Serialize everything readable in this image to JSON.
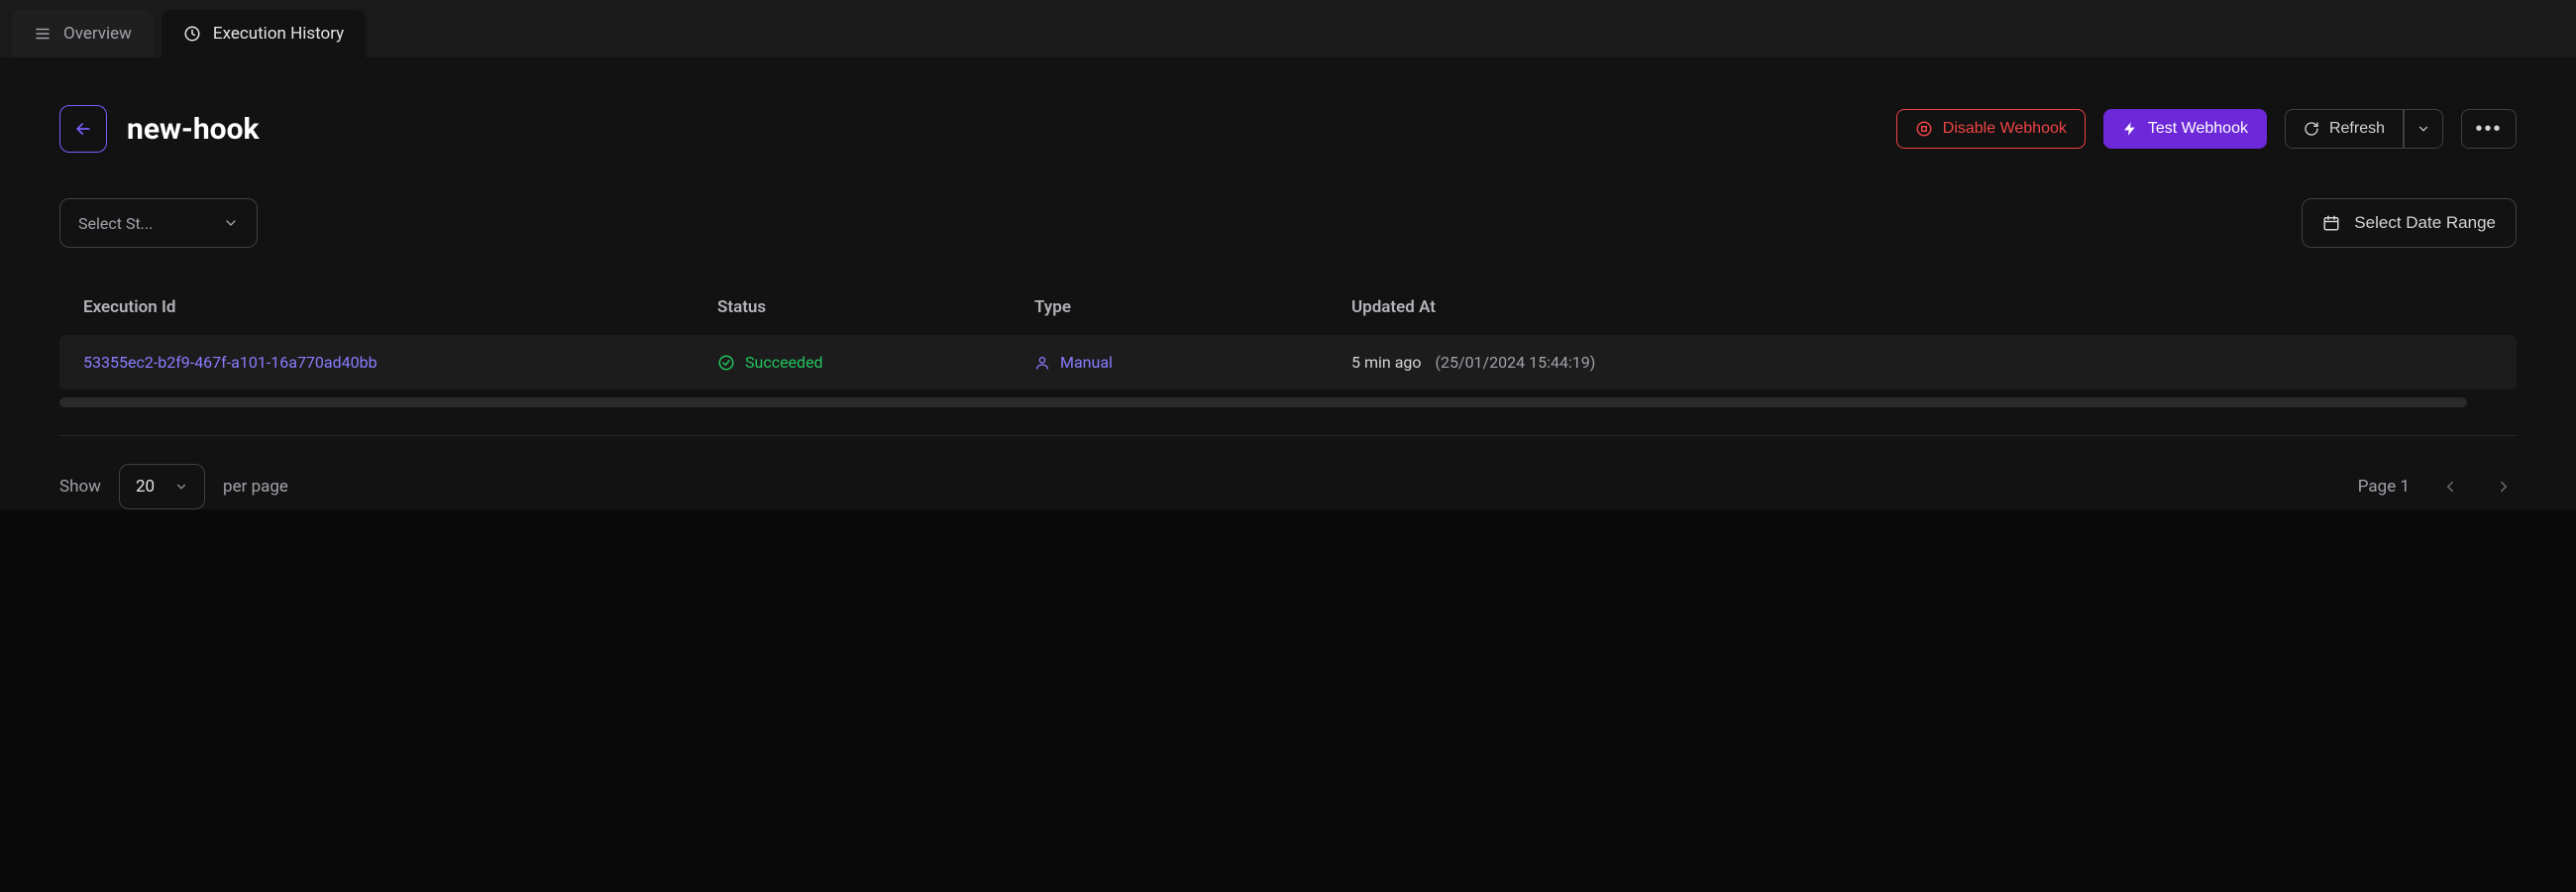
{
  "tabs": {
    "overview": "Overview",
    "history": "Execution History"
  },
  "header": {
    "title": "new-hook",
    "disable_label": "Disable Webhook",
    "test_label": "Test Webhook",
    "refresh_label": "Refresh"
  },
  "filters": {
    "status_placeholder": "Select St...",
    "date_range_label": "Select Date Range"
  },
  "table": {
    "headers": {
      "id": "Execution Id",
      "status": "Status",
      "type": "Type",
      "updated": "Updated At"
    },
    "rows": [
      {
        "id": "53355ec2-b2f9-467f-a101-16a770ad40bb",
        "status": "Succeeded",
        "type": "Manual",
        "updated_relative": "5 min ago",
        "updated_absolute": "(25/01/2024 15:44:19)"
      }
    ]
  },
  "footer": {
    "show_label": "Show",
    "page_size": "20",
    "per_page_label": "per page",
    "page_label": "Page 1"
  }
}
